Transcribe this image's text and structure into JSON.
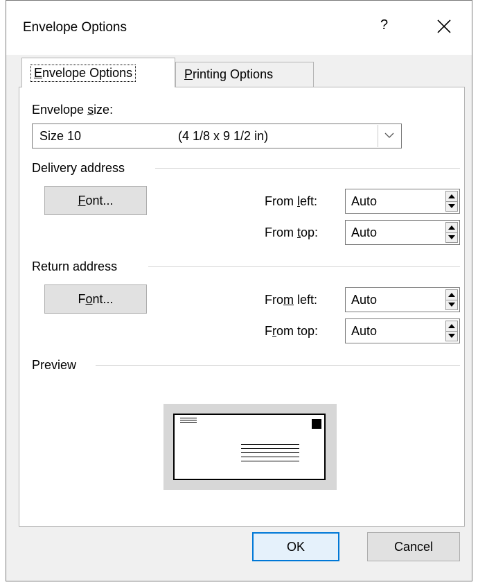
{
  "window": {
    "title": "Envelope Options",
    "help": "?",
    "close": "✕"
  },
  "tabs": [
    {
      "pre": "",
      "key": "E",
      "post": "nvelope Options"
    },
    {
      "pre": "",
      "key": "P",
      "post": "rinting Options"
    }
  ],
  "envelope_size": {
    "label_pre": "Envelope ",
    "label_key": "s",
    "label_post": "ize:",
    "selected_name": "Size 10",
    "selected_dims": "(4 1/8 x 9 1/2 in)"
  },
  "delivery": {
    "heading": "Delivery address",
    "font_button": {
      "pre": "",
      "key": "F",
      "post": "ont..."
    },
    "from_left": {
      "pre": "From ",
      "key": "l",
      "post": "eft:",
      "value": "Auto"
    },
    "from_top": {
      "pre": "From ",
      "key": "t",
      "post": "op:",
      "value": "Auto"
    }
  },
  "return": {
    "heading": "Return address",
    "font_button": {
      "pre": "F",
      "key": "o",
      "post": "nt..."
    },
    "from_left": {
      "pre": "Fro",
      "key": "m",
      "post": " left:",
      "value": "Auto"
    },
    "from_top": {
      "pre": "F",
      "key": "r",
      "post": "om top:",
      "value": "Auto"
    }
  },
  "preview": {
    "heading": "Preview"
  },
  "footer": {
    "ok": "OK",
    "cancel": "Cancel"
  }
}
